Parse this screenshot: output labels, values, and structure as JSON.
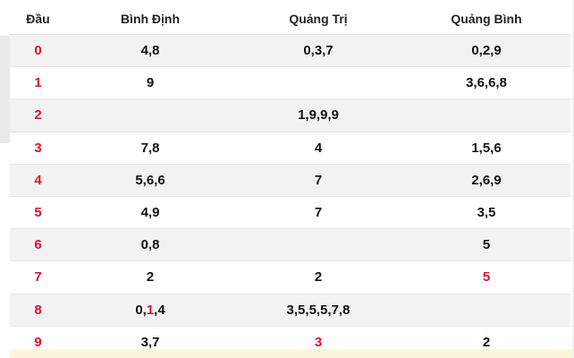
{
  "table": {
    "headers": [
      "Đầu",
      "Bình Định",
      "Quảng Trị",
      "Quảng Bình"
    ],
    "rows": [
      {
        "head": "0",
        "cells": [
          [
            {
              "t": "4,8"
            }
          ],
          [
            {
              "t": "0,3,7"
            }
          ],
          [
            {
              "t": "0,2,9"
            }
          ]
        ]
      },
      {
        "head": "1",
        "cells": [
          [
            {
              "t": "9"
            }
          ],
          [],
          [
            {
              "t": "3,6,6,8"
            }
          ]
        ]
      },
      {
        "head": "2",
        "cells": [
          [],
          [
            {
              "t": "1,9,9,9"
            }
          ],
          []
        ]
      },
      {
        "head": "3",
        "cells": [
          [
            {
              "t": "7,8"
            }
          ],
          [
            {
              "t": "4"
            }
          ],
          [
            {
              "t": "1,5,6"
            }
          ]
        ]
      },
      {
        "head": "4",
        "cells": [
          [
            {
              "t": "5,6,6"
            }
          ],
          [
            {
              "t": "7"
            }
          ],
          [
            {
              "t": "2,6,9"
            }
          ]
        ]
      },
      {
        "head": "5",
        "cells": [
          [
            {
              "t": "4,9"
            }
          ],
          [
            {
              "t": "7"
            }
          ],
          [
            {
              "t": "3,5"
            }
          ]
        ]
      },
      {
        "head": "6",
        "cells": [
          [
            {
              "t": "0,8"
            }
          ],
          [],
          [
            {
              "t": "5"
            }
          ]
        ]
      },
      {
        "head": "7",
        "cells": [
          [
            {
              "t": "2"
            }
          ],
          [
            {
              "t": "2"
            }
          ],
          [
            {
              "t": "5",
              "hl": true
            }
          ]
        ]
      },
      {
        "head": "8",
        "cells": [
          [
            {
              "t": "0,"
            },
            {
              "t": "1",
              "hl": true
            },
            {
              "t": ",4"
            }
          ],
          [
            {
              "t": "3,5,5,5,7,8"
            }
          ],
          []
        ]
      },
      {
        "head": "9",
        "cells": [
          [
            {
              "t": "3,7"
            }
          ],
          [
            {
              "t": "3",
              "hl": true
            }
          ],
          [
            {
              "t": "2"
            }
          ]
        ]
      }
    ]
  },
  "colors": {
    "highlight": "#e0102b",
    "row_alt": "#f2f2f2",
    "text": "#111111"
  }
}
